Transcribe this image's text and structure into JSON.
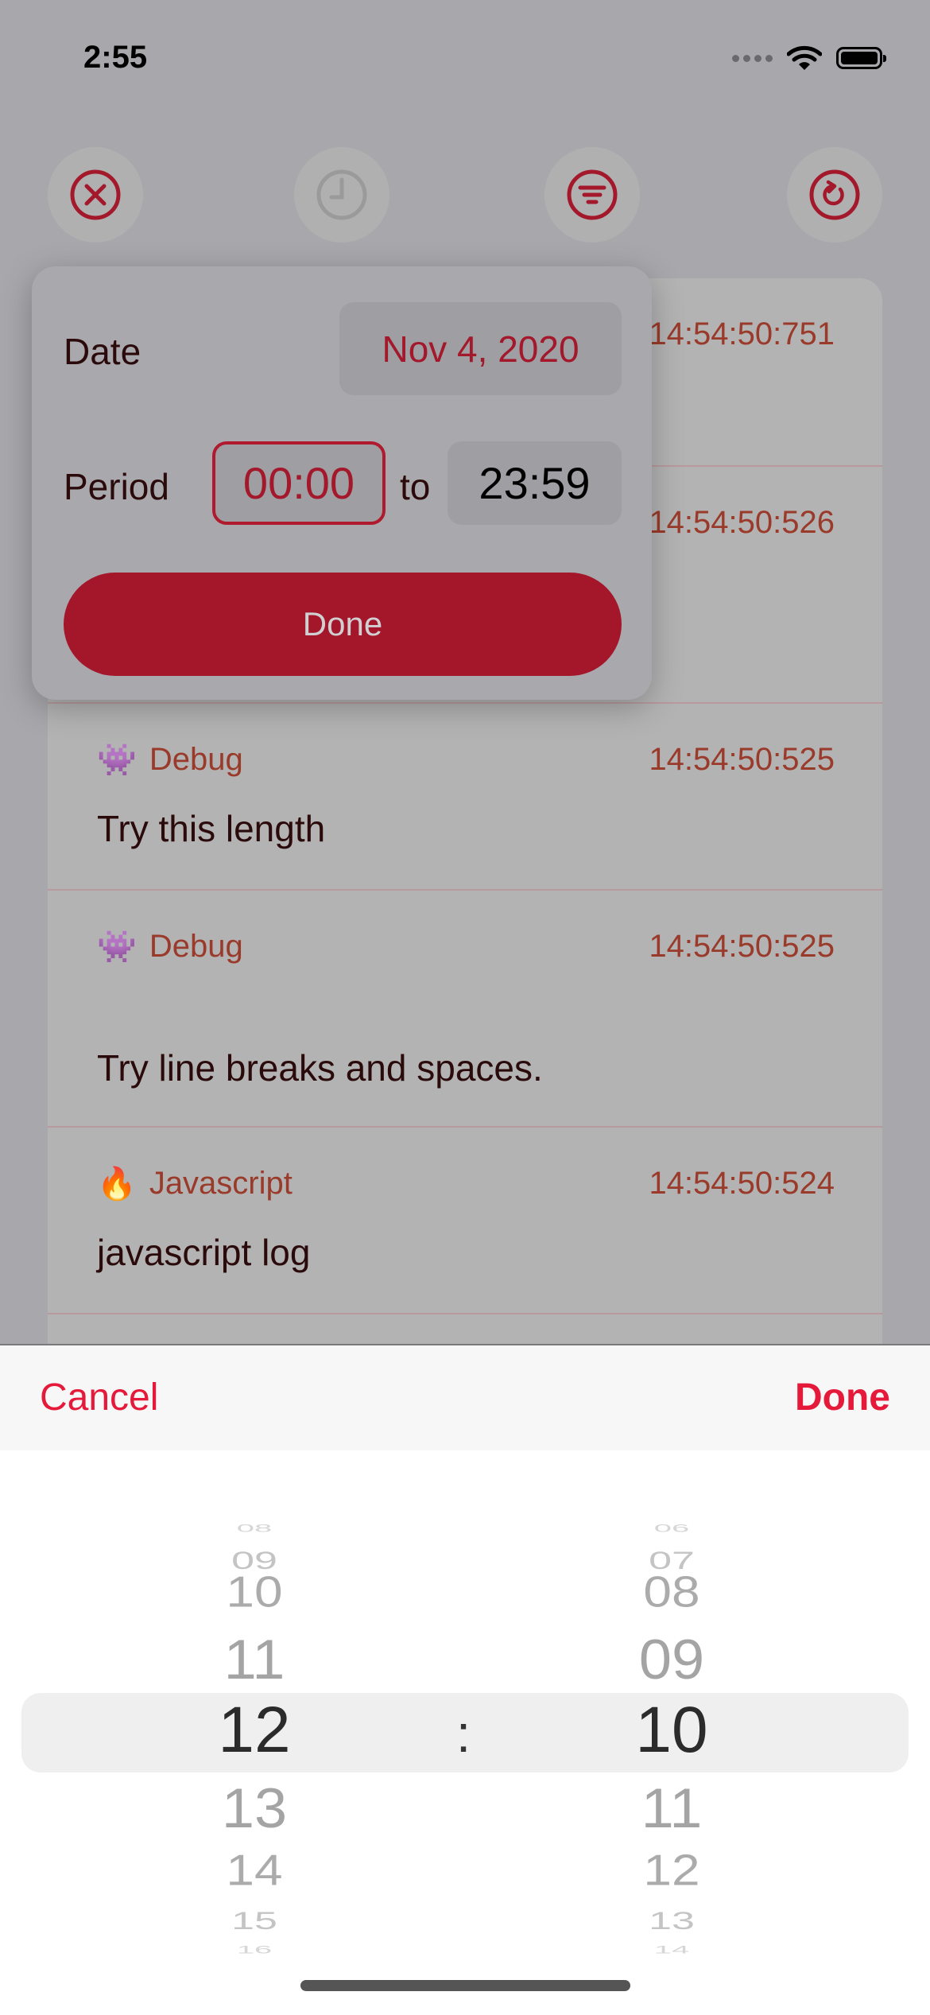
{
  "status_bar": {
    "time": "2:55"
  },
  "toolbar_icons": [
    {
      "name": "close-circle-icon",
      "color": "#a3182b"
    },
    {
      "name": "clock-icon",
      "color": "#9a9a9a"
    },
    {
      "name": "filter-icon",
      "color": "#a3182b"
    },
    {
      "name": "refresh-icon",
      "color": "#a3182b"
    }
  ],
  "logs": [
    {
      "time": "14:54:50:751"
    },
    {
      "time": "14:54:50:526"
    },
    {
      "emoji": "👾",
      "level": "Debug",
      "time": "14:54:50:525",
      "message": "Try this length"
    },
    {
      "emoji": "👾",
      "level": "Debug",
      "time": "14:54:50:525",
      "message": "Try line breaks and spaces."
    },
    {
      "emoji": "🔥",
      "level": "Javascript",
      "time": "14:54:50:524",
      "message": "javascript log"
    }
  ],
  "filter_popup": {
    "date_label": "Date",
    "date_value": "Nov 4, 2020",
    "period_label": "Period",
    "period_from": "00:00",
    "to_label": "to",
    "period_to": "23:59",
    "done_label": "Done"
  },
  "picker_sheet": {
    "cancel_label": "Cancel",
    "done_label": "Done",
    "separator": ":",
    "hours": [
      "08",
      "09",
      "10",
      "11",
      "12",
      "13",
      "14",
      "15",
      "16"
    ],
    "minutes": [
      "06",
      "07",
      "08",
      "09",
      "10",
      "11",
      "12",
      "13",
      "14"
    ],
    "selected_hour": "12",
    "selected_minute": "10",
    "accent_color": "#e5193a"
  }
}
